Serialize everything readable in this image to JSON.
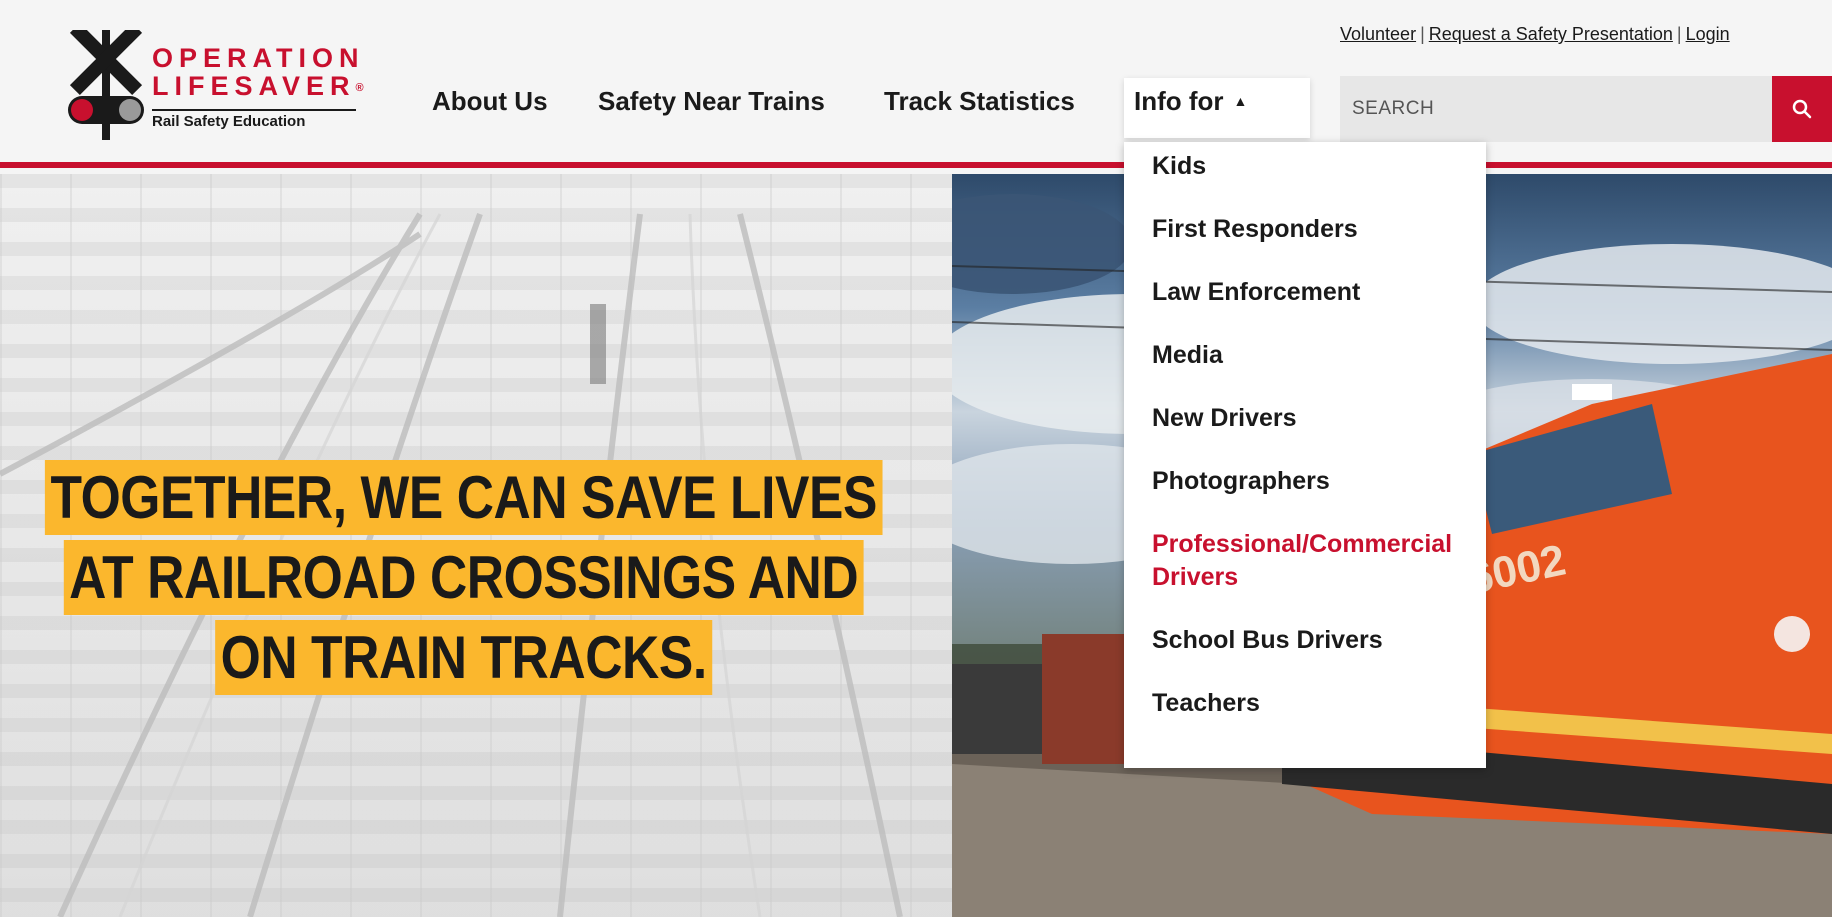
{
  "brand": {
    "line1": "OPERATION",
    "line2": "LIFESAVER",
    "registered": "®",
    "tagline": "Rail Safety Education",
    "red": "#c8102e",
    "icon": "railroad-crossing-icon"
  },
  "nav": {
    "items": [
      {
        "label": "About Us"
      },
      {
        "label": "Safety Near Trains"
      },
      {
        "label": "Track Statistics"
      }
    ],
    "info_for": {
      "label": "Info for",
      "caret": "▲"
    }
  },
  "top_links": {
    "volunteer": "Volunteer",
    "sep1": "|",
    "request": "Request a Safety Presentation",
    "sep2": "|",
    "login": "Login"
  },
  "search": {
    "placeholder": "SEARCH",
    "icon": "search-icon"
  },
  "dropdown": {
    "items": [
      {
        "label": "Kids"
      },
      {
        "label": "First Responders"
      },
      {
        "label": "Law Enforcement"
      },
      {
        "label": "Media"
      },
      {
        "label": "New Drivers"
      },
      {
        "label": "Photographers"
      },
      {
        "label": "Professional/Commercial Drivers",
        "active": true
      },
      {
        "label": "School Bus Drivers"
      },
      {
        "label": "Teachers"
      }
    ]
  },
  "hero": {
    "headline_line1": "TOGETHER, WE CAN SAVE LIVES",
    "headline_line2": "AT RAILROAD CROSSINGS AND",
    "headline_line3": "ON TRAIN TRACKS.",
    "highlight_color": "#fbb72d",
    "locomotive_number": "6002"
  }
}
